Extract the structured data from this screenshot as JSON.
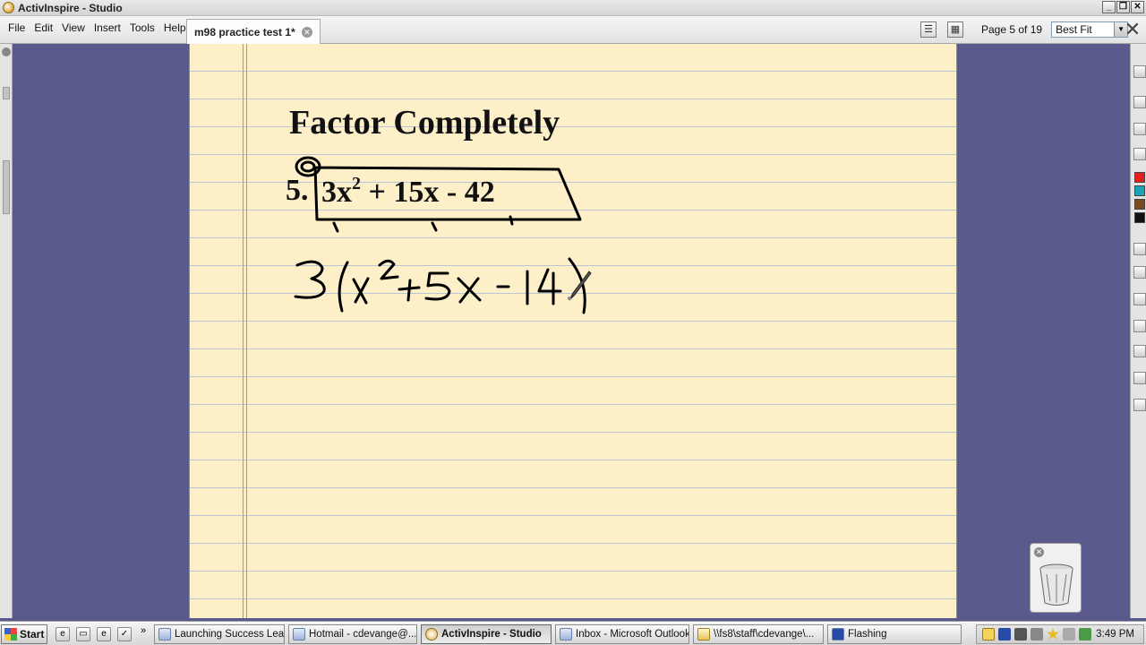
{
  "window": {
    "title": "ActivInspire - Studio"
  },
  "menu": {
    "items": [
      {
        "label": "File"
      },
      {
        "label": "Edit"
      },
      {
        "label": "View"
      },
      {
        "label": "Insert"
      },
      {
        "label": "Tools"
      },
      {
        "label": "Help"
      }
    ]
  },
  "document_tab": {
    "label": "m98 practice test 1*"
  },
  "toolbar": {
    "page_status": "Page 5 of 19",
    "zoom": "Best Fit"
  },
  "flipchart": {
    "heading": "Factor Completely",
    "question_number": "5.",
    "expression_coef": "3x",
    "expression_exp": "2",
    "expression_rest": " + 15x - 42",
    "handwritten_work": "3(x² + 5x - 14)"
  },
  "right_palette": {
    "colors": [
      "#e61e1e",
      "#1aa4b4",
      "#7a4a22",
      "#111111"
    ]
  },
  "taskbar": {
    "start_label": "Start",
    "tasks": [
      {
        "label": "Launching Success Lea..."
      },
      {
        "label": "Hotmail - cdevange@..."
      },
      {
        "label": "ActivInspire - Studio"
      },
      {
        "label": "Inbox - Microsoft Outlook"
      },
      {
        "label": "\\\\fs8\\staff\\cdevange\\..."
      },
      {
        "label": "Flashing"
      }
    ],
    "clock": "3:49 PM"
  }
}
